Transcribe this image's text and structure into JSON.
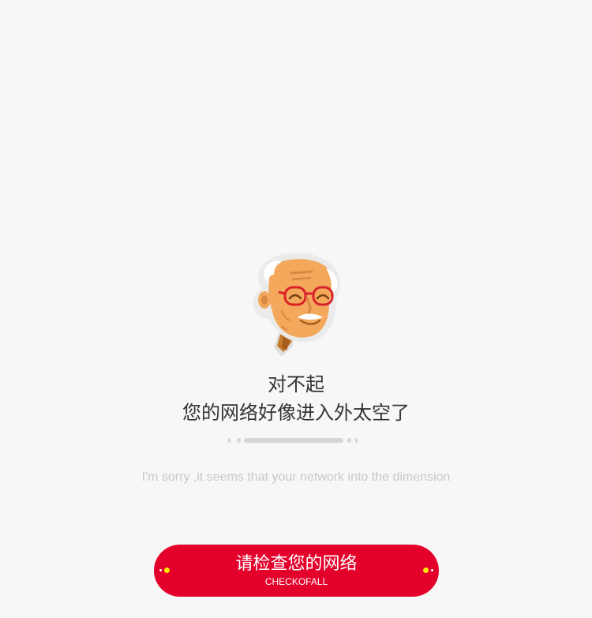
{
  "error_page": {
    "title_line_1": "对不起",
    "title_line_2": "您的网络好像进入外太空了",
    "subtitle": "I'm sorry ,it seems that your network into the dimension",
    "mascot_icon": "old-man-mascot-icon"
  },
  "check_button": {
    "label": "请检查您的网络",
    "sublabel": "CHECKOFALL"
  },
  "colors": {
    "background": "#f7f7f7",
    "accent": "#e3002b",
    "dot_yellow": "#ffe600",
    "text_dark": "#333333",
    "text_muted": "#c8c8c8",
    "divider": "#d6d6d6"
  }
}
